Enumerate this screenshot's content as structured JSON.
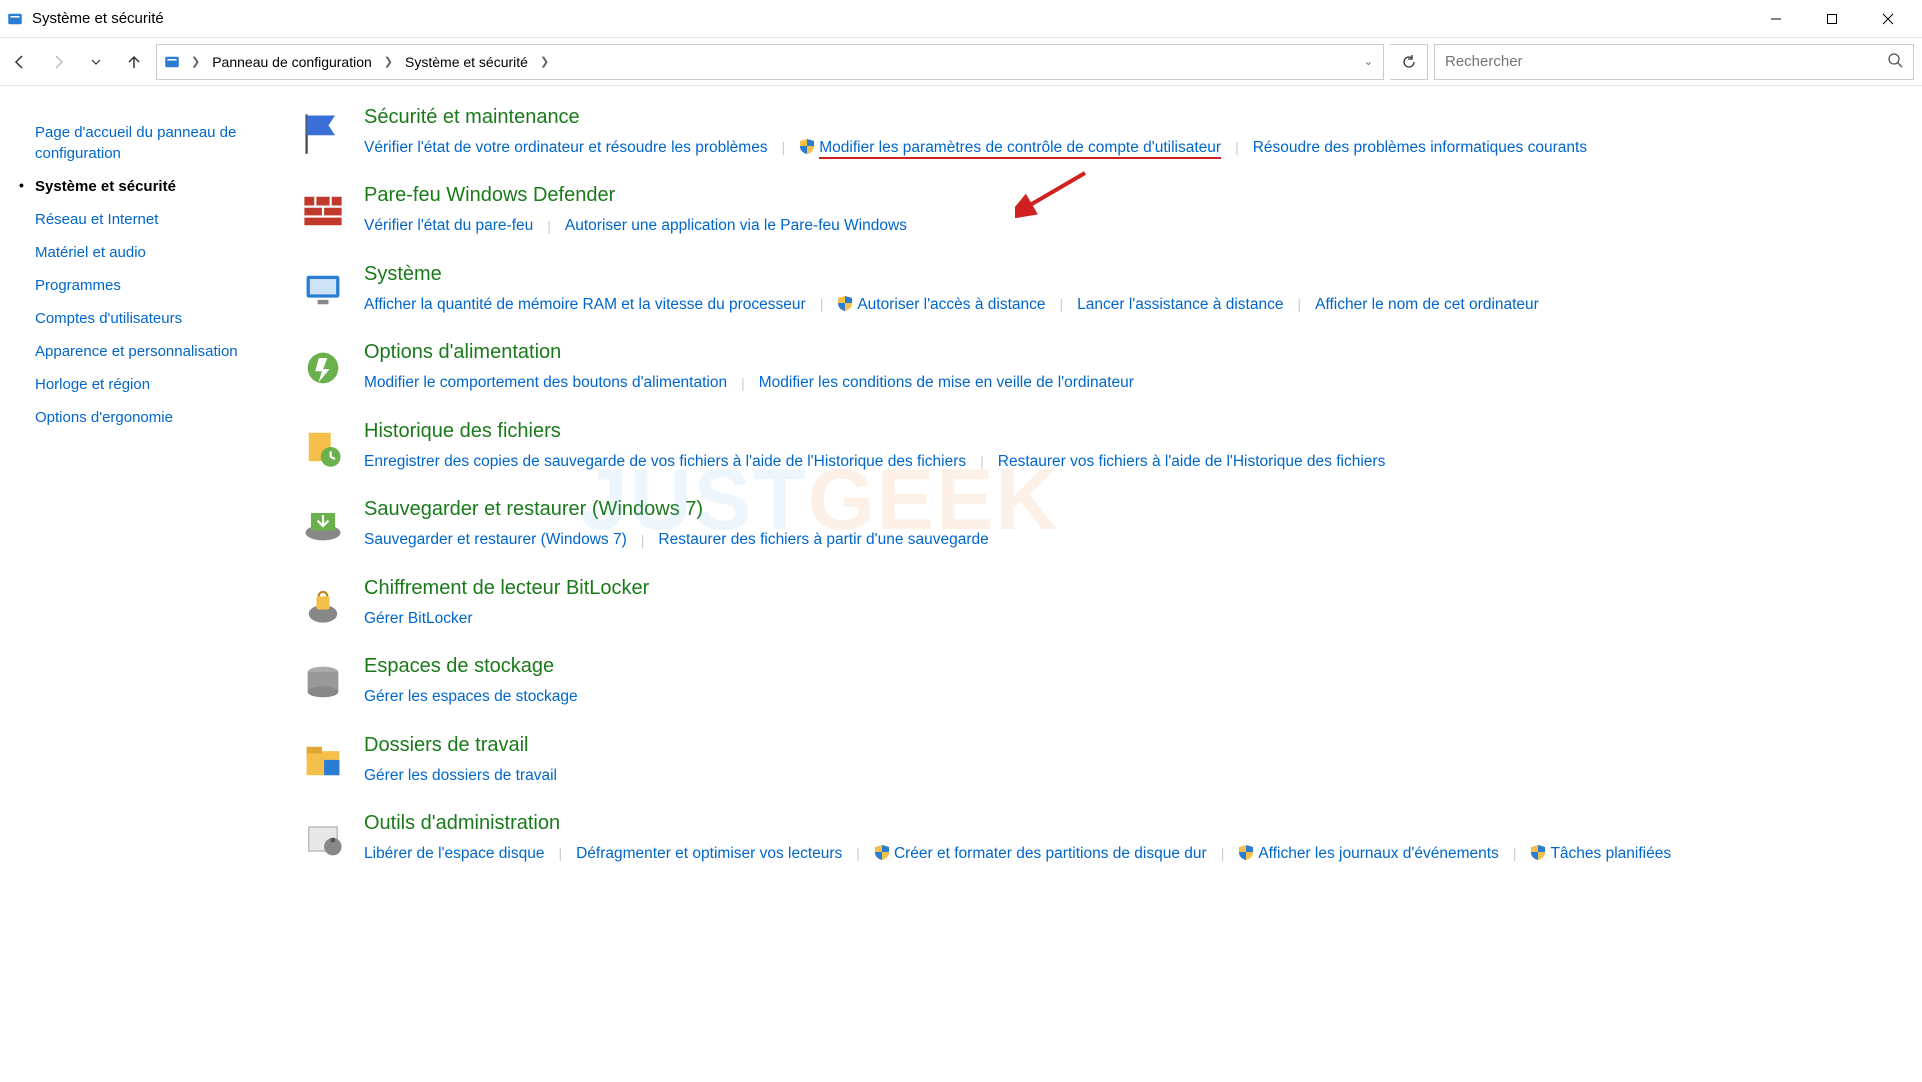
{
  "window": {
    "title": "Système et sécurité"
  },
  "breadcrumb": {
    "root": "Panneau de configuration",
    "current": "Système et sécurité"
  },
  "search": {
    "placeholder": "Rechercher"
  },
  "sidebar": {
    "home": "Page d'accueil du panneau de configuration",
    "items": [
      "Système et sécurité",
      "Réseau et Internet",
      "Matériel et audio",
      "Programmes",
      "Comptes d'utilisateurs",
      "Apparence et personnalisation",
      "Horloge et région",
      "Options d'ergonomie"
    ],
    "active_index": 0
  },
  "categories": [
    {
      "title": "Sécurité et maintenance",
      "icon": "flag",
      "links": [
        {
          "text": "Vérifier l'état de votre ordinateur et résoudre les problèmes",
          "shield": false
        },
        {
          "text": "Modifier les paramètres de contrôle de compte d'utilisateur",
          "shield": true,
          "highlight": true
        },
        {
          "text": "Résoudre des problèmes informatiques courants",
          "shield": false
        }
      ]
    },
    {
      "title": "Pare-feu Windows Defender",
      "icon": "firewall",
      "links": [
        {
          "text": "Vérifier l'état du pare-feu",
          "shield": false
        },
        {
          "text": "Autoriser une application via le Pare-feu Windows",
          "shield": false
        }
      ]
    },
    {
      "title": "Système",
      "icon": "system",
      "links": [
        {
          "text": "Afficher la quantité de mémoire RAM et la vitesse du processeur",
          "shield": false
        },
        {
          "text": "Autoriser l'accès à distance",
          "shield": true
        },
        {
          "text": "Lancer l'assistance à distance",
          "shield": false
        },
        {
          "text": "Afficher le nom de cet ordinateur",
          "shield": false
        }
      ]
    },
    {
      "title": "Options d'alimentation",
      "icon": "power",
      "links": [
        {
          "text": "Modifier le comportement des boutons d'alimentation",
          "shield": false
        },
        {
          "text": "Modifier les conditions de mise en veille de l'ordinateur",
          "shield": false
        }
      ]
    },
    {
      "title": "Historique des fichiers",
      "icon": "history",
      "links": [
        {
          "text": "Enregistrer des copies de sauvegarde de vos fichiers à l'aide de l'Historique des fichiers",
          "shield": false
        },
        {
          "text": "Restaurer vos fichiers à l'aide de l'Historique des fichiers",
          "shield": false
        }
      ]
    },
    {
      "title": "Sauvegarder et restaurer (Windows 7)",
      "icon": "backup",
      "links": [
        {
          "text": "Sauvegarder et restaurer (Windows 7)",
          "shield": false
        },
        {
          "text": "Restaurer des fichiers à partir d'une sauvegarde",
          "shield": false
        }
      ]
    },
    {
      "title": "Chiffrement de lecteur BitLocker",
      "icon": "bitlocker",
      "links": [
        {
          "text": "Gérer BitLocker",
          "shield": false
        }
      ]
    },
    {
      "title": "Espaces de stockage",
      "icon": "storage",
      "links": [
        {
          "text": "Gérer les espaces de stockage",
          "shield": false
        }
      ]
    },
    {
      "title": "Dossiers de travail",
      "icon": "workfolders",
      "links": [
        {
          "text": "Gérer les dossiers de travail",
          "shield": false
        }
      ]
    },
    {
      "title": "Outils d'administration",
      "icon": "admintools",
      "links": [
        {
          "text": "Libérer de l'espace disque",
          "shield": false
        },
        {
          "text": "Défragmenter et optimiser vos lecteurs",
          "shield": false
        },
        {
          "text": "Créer et formater des partitions de disque dur",
          "shield": true
        },
        {
          "text": "Afficher les journaux d'événements",
          "shield": true
        },
        {
          "text": "Tâches planifiées",
          "shield": true
        }
      ]
    }
  ],
  "watermark": {
    "part1": "JUST",
    "part2": "GEEK"
  }
}
